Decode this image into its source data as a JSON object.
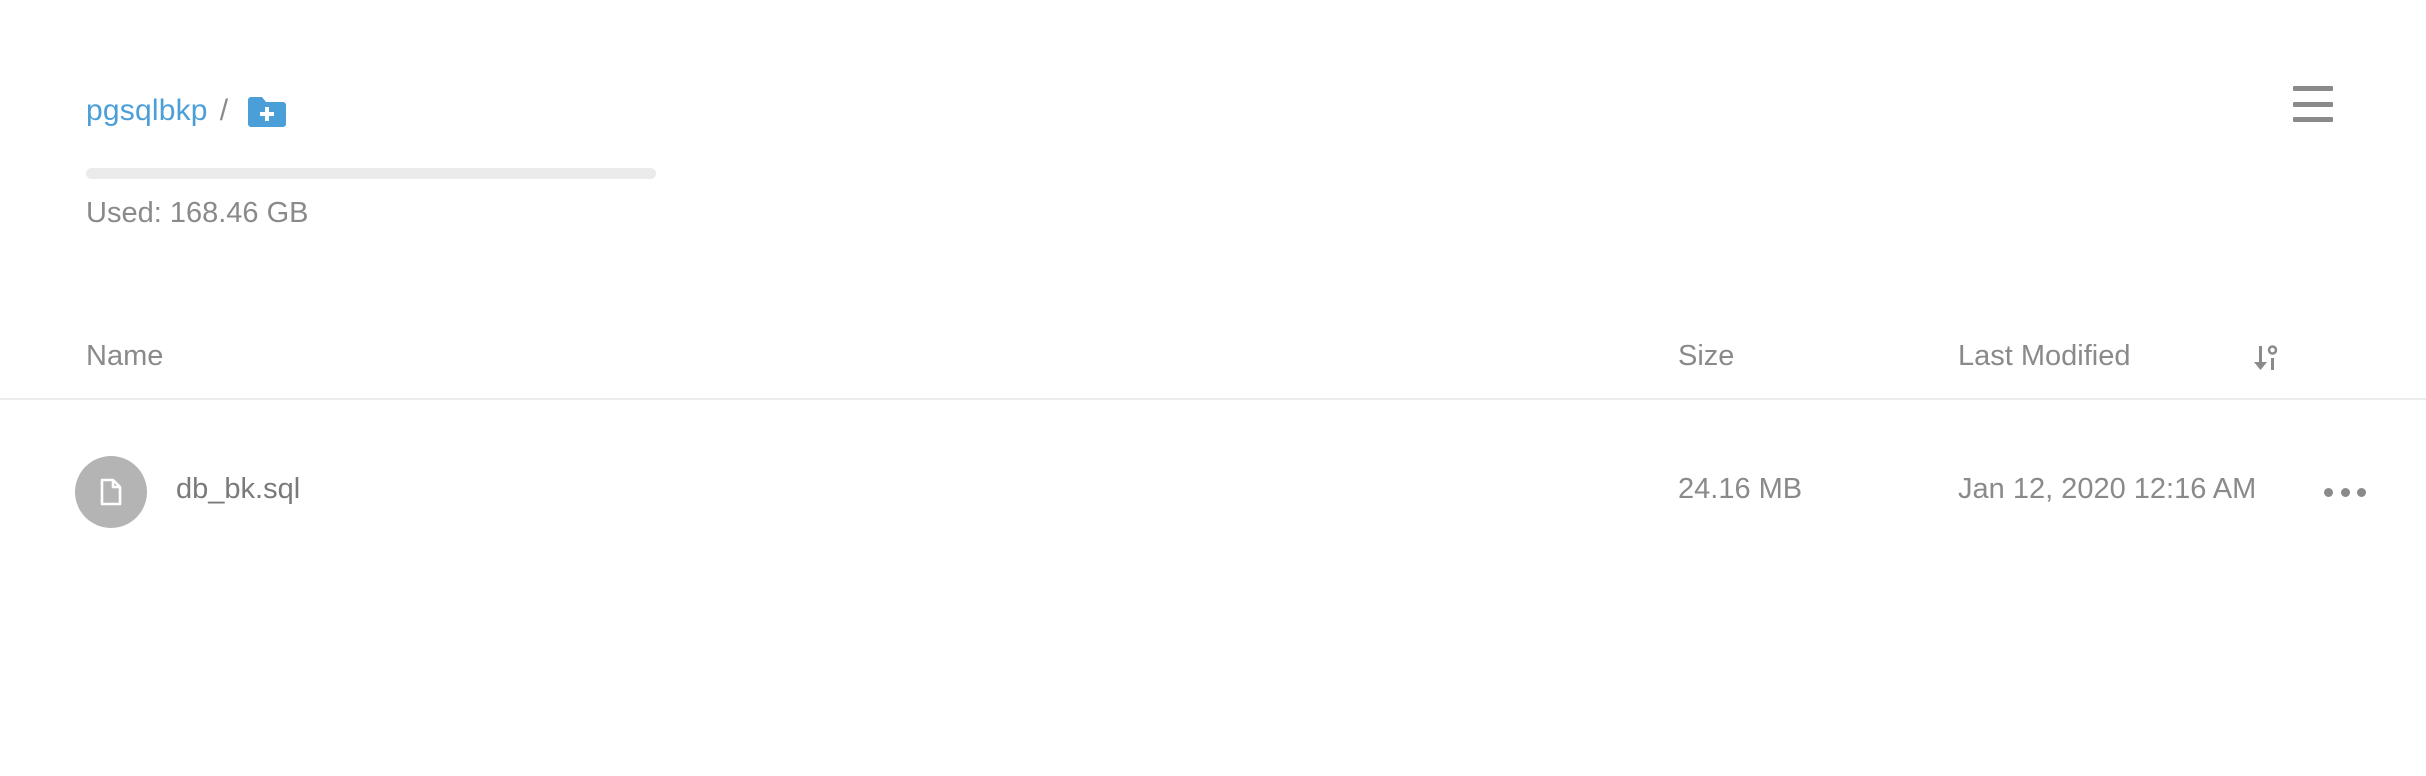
{
  "breadcrumb": {
    "bucket": "pgsqlbkp",
    "separator": "/",
    "add_folder_icon": "folder-plus-icon"
  },
  "menu": {
    "icon": "hamburger-menu-icon"
  },
  "usage": {
    "label": "Used: 168.46 GB",
    "fill_fraction": 0.0,
    "track_color": "#ebebeb",
    "fill_color": "#4a9fd8"
  },
  "table": {
    "columns": {
      "name": "Name",
      "size": "Size",
      "last_modified": "Last Modified"
    },
    "sort_icon": "sort-descending-icon",
    "rows": [
      {
        "icon": "file-icon",
        "name": "db_bk.sql",
        "size": "24.16 MB",
        "last_modified": "Jan 12, 2020 12:16 AM",
        "actions_icon": "more-horizontal-icon"
      }
    ]
  },
  "colors": {
    "accent": "#4a9fd8",
    "text_muted": "#8a8a8a",
    "file_icon_bg": "#b4b4b4"
  }
}
